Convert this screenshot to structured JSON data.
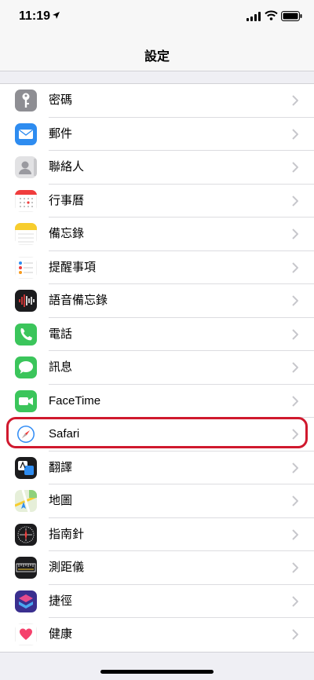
{
  "status_bar": {
    "time": "11:19"
  },
  "nav": {
    "title": "設定"
  },
  "items": [
    {
      "label": "密碼",
      "icon": "key-icon"
    },
    {
      "label": "郵件",
      "icon": "mail-icon"
    },
    {
      "label": "聯絡人",
      "icon": "contacts-icon"
    },
    {
      "label": "行事曆",
      "icon": "calendar-icon"
    },
    {
      "label": "備忘錄",
      "icon": "notes-icon"
    },
    {
      "label": "提醒事項",
      "icon": "reminders-icon"
    },
    {
      "label": "語音備忘錄",
      "icon": "voice-memos-icon"
    },
    {
      "label": "電話",
      "icon": "phone-icon"
    },
    {
      "label": "訊息",
      "icon": "messages-icon"
    },
    {
      "label": "FaceTime",
      "icon": "facetime-icon"
    },
    {
      "label": "Safari",
      "icon": "safari-icon"
    },
    {
      "label": "翻譯",
      "icon": "translate-icon"
    },
    {
      "label": "地圖",
      "icon": "maps-icon"
    },
    {
      "label": "指南針",
      "icon": "compass-icon"
    },
    {
      "label": "測距儀",
      "icon": "measure-icon"
    },
    {
      "label": "捷徑",
      "icon": "shortcuts-icon"
    },
    {
      "label": "健康",
      "icon": "health-icon"
    }
  ],
  "colors": {
    "highlight": "#d0192e",
    "chevron": "#c7c7cc",
    "background": "#efeff4"
  }
}
